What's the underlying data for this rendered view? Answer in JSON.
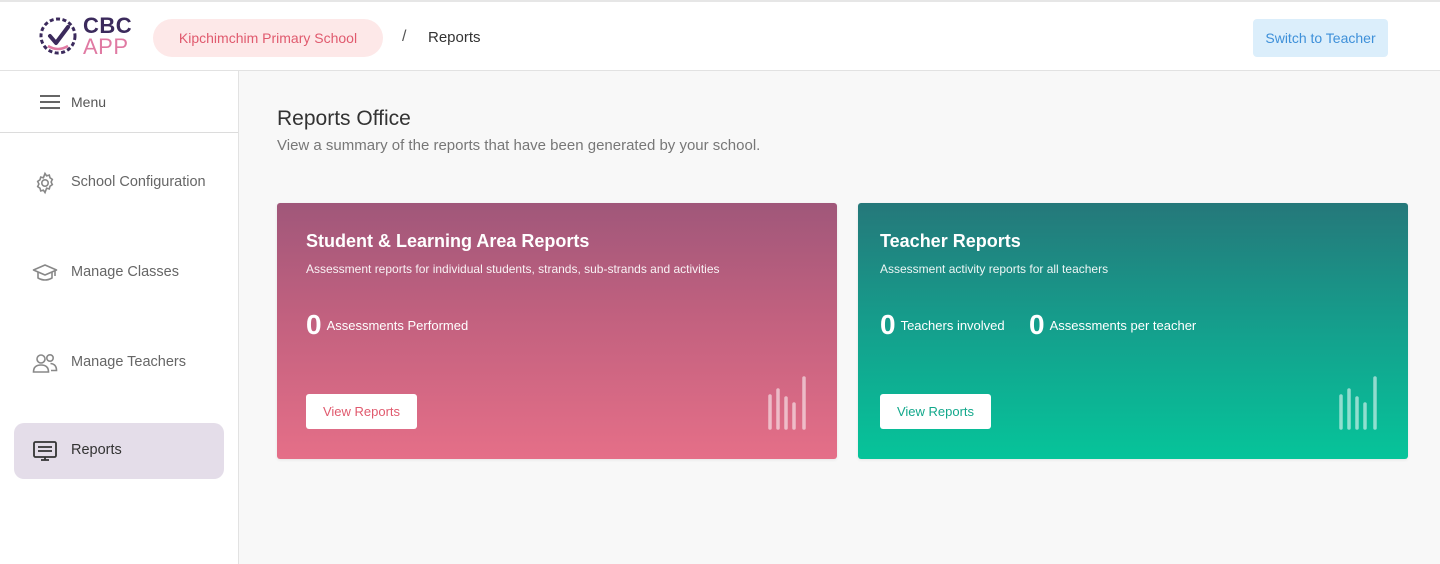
{
  "header": {
    "logo_line1": "CBC",
    "logo_line2": "APP",
    "school_name": "Kipchimchim Primary School",
    "breadcrumb_separator": "/",
    "breadcrumb_current": "Reports",
    "switch_button_label": "Switch to Teacher"
  },
  "sidebar": {
    "menu_label": "Menu",
    "items": [
      {
        "label": "School Configuration",
        "icon": "gear-icon",
        "active": false
      },
      {
        "label": "Manage Classes",
        "icon": "graduation-cap-icon",
        "active": false
      },
      {
        "label": "Manage Teachers",
        "icon": "users-icon",
        "active": false
      },
      {
        "label": "Reports",
        "icon": "monitor-report-icon",
        "active": true
      }
    ]
  },
  "main": {
    "title": "Reports Office",
    "subtitle": "View a summary of the reports that have been generated by your school.",
    "cards": [
      {
        "title": "Student & Learning Area Reports",
        "description": "Assessment reports for individual students, strands, sub-strands and activities",
        "stats": [
          {
            "value": "0",
            "label": "Assessments Performed"
          }
        ],
        "button_label": "View Reports",
        "icon": "bar-chart-icon"
      },
      {
        "title": "Teacher Reports",
        "description": "Assessment activity reports for all teachers",
        "stats": [
          {
            "value": "0",
            "label": "Teachers involved"
          },
          {
            "value": "0",
            "label": "Assessments per teacher"
          }
        ],
        "button_label": "View Reports",
        "icon": "bar-chart-icon"
      }
    ]
  },
  "colors": {
    "student_card_top": "#a0577a",
    "student_card_bottom": "#e56f88",
    "teacher_card_top": "#25787a",
    "teacher_card_bottom": "#06c49a",
    "active_nav_bg": "#e4dde9",
    "school_pill_bg": "#fde8e8",
    "school_pill_text": "#e05a6e",
    "switch_button_bg": "#dbeefb",
    "switch_button_text": "#3e90d9"
  }
}
